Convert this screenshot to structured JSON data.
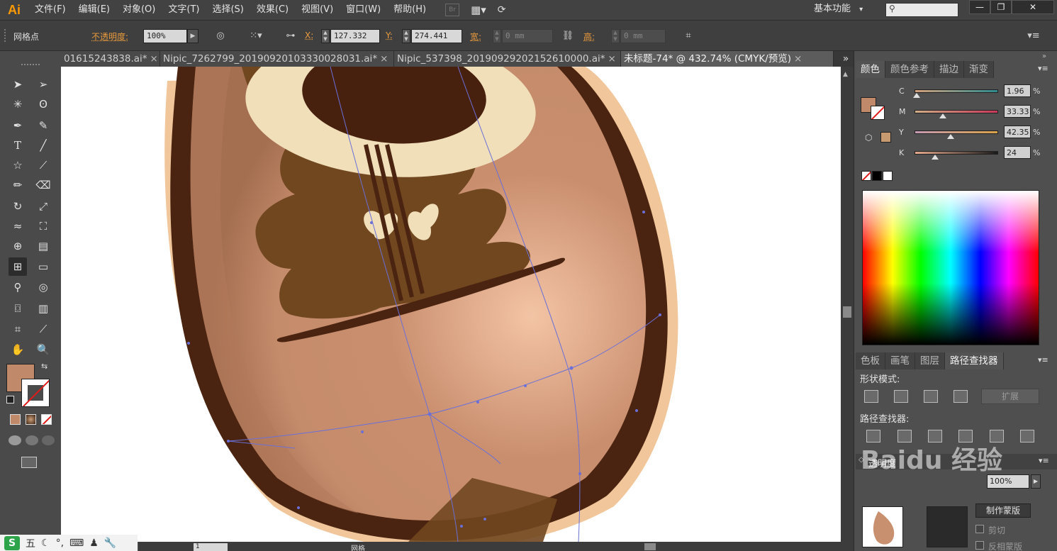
{
  "app": {
    "logo": "Ai",
    "menus": [
      "文件(F)",
      "编辑(E)",
      "对象(O)",
      "文字(T)",
      "选择(S)",
      "效果(C)",
      "视图(V)",
      "窗口(W)",
      "帮助(H)"
    ],
    "br_label": "Br",
    "workspace": "基本功能",
    "workspace_arrow": "▾",
    "window_buttons": [
      "—",
      "❐",
      "✕"
    ]
  },
  "control_bar": {
    "tool_name": "网格点",
    "opacity_label": "不透明度:",
    "opacity_value": "100%",
    "x_label": "X:",
    "x_value": "127.332",
    "y_label": "Y:",
    "y_value": "274.441",
    "width_label": "宽:",
    "width_value": "0 mm",
    "height_label": "高:",
    "height_value": "0 mm"
  },
  "tabs": [
    {
      "label": "01615243838.ai*",
      "active": false
    },
    {
      "label": "Nipic_7262799_20190920103330028031.ai*",
      "active": false
    },
    {
      "label": "Nipic_537398_20190929202152610000.ai*",
      "active": false
    },
    {
      "label": "未标题-74* @ 432.74% (CMYK/预览)",
      "active": true
    }
  ],
  "tab_close": "×",
  "tab_more": "»",
  "color_panel": {
    "tabs": [
      "颜色",
      "颜色参考",
      "描边",
      "渐变"
    ],
    "fill_color": "#c08a6a",
    "sliders": [
      {
        "label": "C",
        "value": "1.96",
        "pos": 0.02,
        "gradient": "linear-gradient(to right,#d3a07b,#2e8b8f)"
      },
      {
        "label": "M",
        "value": "33.33",
        "pos": 0.33,
        "gradient": "linear-gradient(to right,#d0ad86,#c8395a)"
      },
      {
        "label": "Y",
        "value": "42.35",
        "pos": 0.42,
        "gradient": "linear-gradient(to right,#c59ab3,#d8a24a)"
      },
      {
        "label": "K",
        "value": "24",
        "pos": 0.24,
        "gradient": "linear-gradient(to right,#e4a98c,#1a1a1a)"
      }
    ],
    "pct": "%"
  },
  "pathfinder_panel": {
    "tabs": [
      "色板",
      "画笔",
      "图层",
      "路径查找器"
    ],
    "shape_modes_label": "形状模式:",
    "pathfinders_label": "路径查找器:",
    "expand_label": "扩展"
  },
  "transparency_panel": {
    "title": "透明度",
    "opacity_value": "100%",
    "make_mask_label": "制作蒙版",
    "clip_label": "剪切",
    "invert_label": "反相蒙版"
  },
  "status": {
    "zoom": "1",
    "status_text": "网格"
  },
  "ime": {
    "s_label": "S",
    "wu_label": "五"
  },
  "watermark": "Baidu 经验"
}
